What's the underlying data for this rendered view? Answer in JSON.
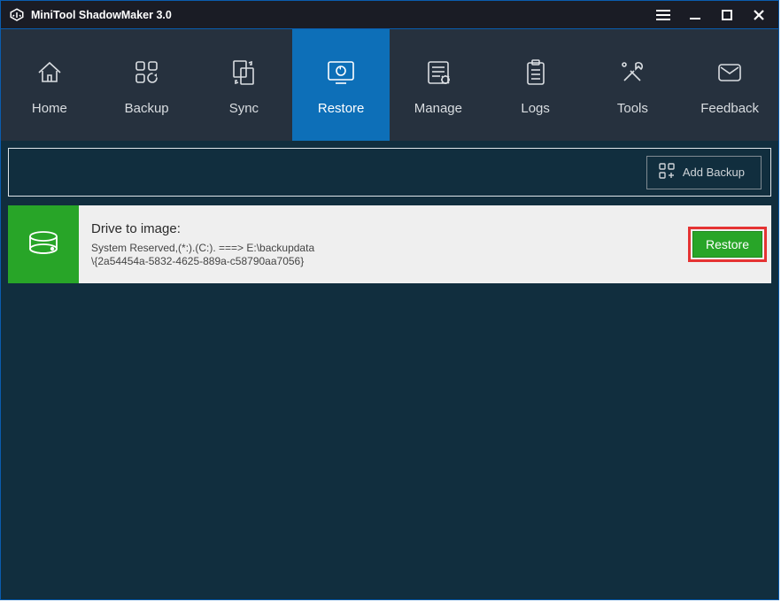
{
  "titlebar": {
    "title": "MiniTool ShadowMaker 3.0"
  },
  "nav": {
    "items": [
      {
        "label": "Home"
      },
      {
        "label": "Backup"
      },
      {
        "label": "Sync"
      },
      {
        "label": "Restore"
      },
      {
        "label": "Manage"
      },
      {
        "label": "Logs"
      },
      {
        "label": "Tools"
      },
      {
        "label": "Feedback"
      }
    ]
  },
  "toolbar": {
    "add_backup": "Add Backup"
  },
  "card": {
    "title": "Drive to image:",
    "detail": "System Reserved,(*:).(C:). ===> E:\\backupdata\n\\{2a54454a-5832-4625-889a-c58790aa7056}",
    "restore": "Restore"
  }
}
